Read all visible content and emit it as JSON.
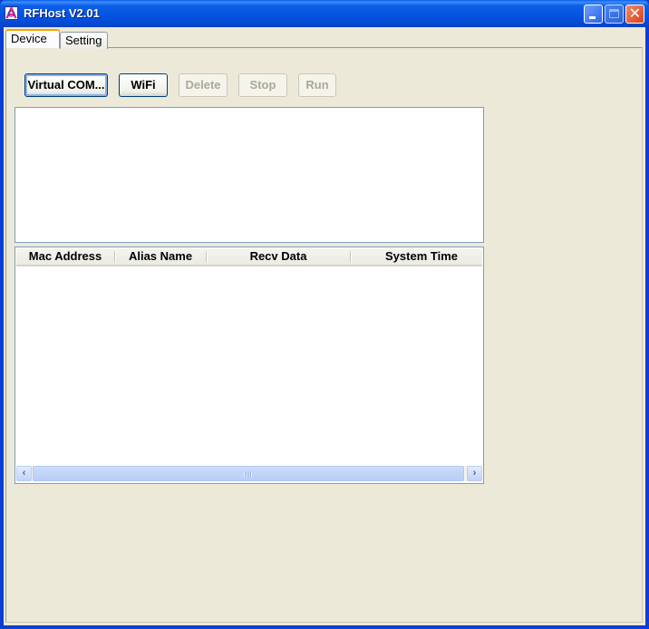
{
  "window": {
    "title": "RFHost V2.01",
    "app_icon": "rfhost-app-icon",
    "controls": {
      "minimize": "minimize-icon",
      "maximize": "maximize-icon",
      "close": "close-icon"
    }
  },
  "tabs": [
    {
      "label": "Device",
      "active": true
    },
    {
      "label": "Setting",
      "active": false
    }
  ],
  "toolbar": {
    "buttons": [
      {
        "label": "Virtual COM...",
        "enabled": true
      },
      {
        "label": "WiFi",
        "enabled": true
      },
      {
        "label": "Delete",
        "enabled": false
      },
      {
        "label": "Stop",
        "enabled": false
      },
      {
        "label": "Run",
        "enabled": false
      }
    ]
  },
  "log": {
    "text": ""
  },
  "device_table": {
    "columns": [
      "Mac Address",
      "Alias Name",
      "Recv Data",
      "System Time"
    ],
    "rows": []
  },
  "scrollbar": {
    "left_arrow": "chevron-left-icon",
    "right_arrow": "chevron-right-icon",
    "left_glyph": "‹",
    "right_glyph": "›"
  },
  "colors": {
    "titlebar": "#0553e0",
    "face": "#ece9d8",
    "border": "#7f9db9",
    "tab_highlight": "#f4a300",
    "disabled_text": "#aca899"
  }
}
